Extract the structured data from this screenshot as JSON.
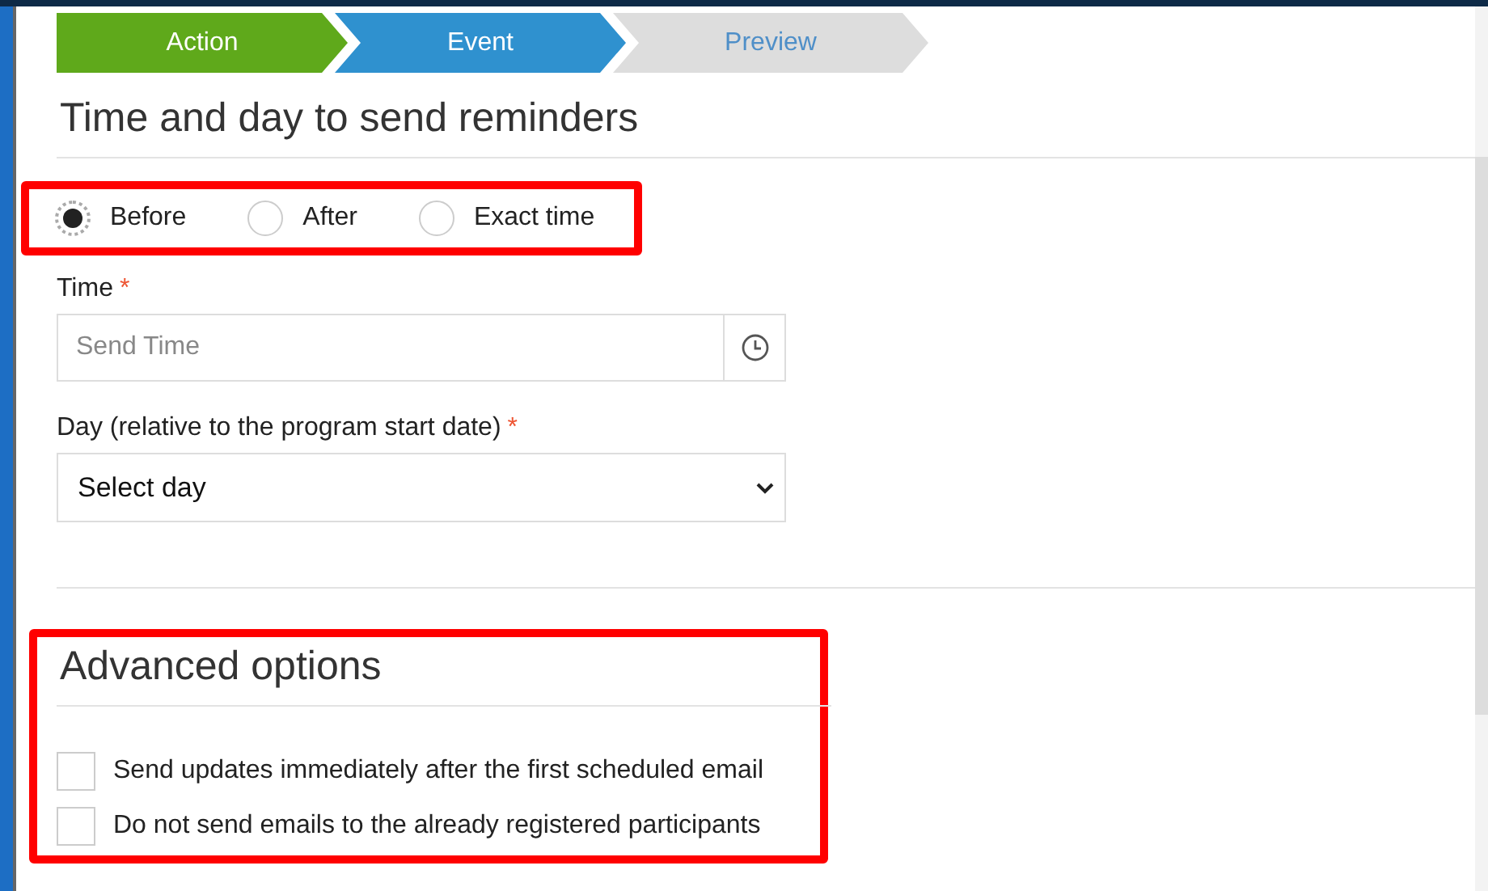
{
  "steps": [
    {
      "label": "Action",
      "completed": true,
      "selected": false
    },
    {
      "label": "Event",
      "completed": false,
      "selected": true
    },
    {
      "label": "Preview",
      "completed": false,
      "selected": false
    }
  ],
  "section_title": "Time and day to send reminders",
  "timing_options": [
    {
      "label": "Before",
      "selected": true
    },
    {
      "label": "After",
      "selected": false
    },
    {
      "label": "Exact time",
      "selected": false
    }
  ],
  "time_field": {
    "label": "Time",
    "required_mark": "*",
    "placeholder": "Send Time"
  },
  "day_field": {
    "label": "Day (relative to the program start date)",
    "required_mark": "*",
    "value": "Select day"
  },
  "advanced": {
    "title": "Advanced options",
    "options": [
      {
        "label": "Send updates immediately after the first scheduled email",
        "checked": false
      },
      {
        "label": "Do not send emails to the already registered participants",
        "checked": false
      }
    ]
  }
}
